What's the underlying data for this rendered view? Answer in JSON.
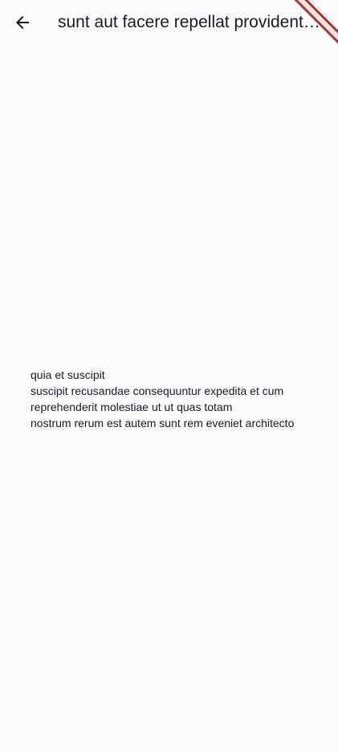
{
  "app_bar": {
    "back_icon": "arrow-back-icon",
    "title": "sunt aut facere repellat provident occaecati excepturi optio reprehenderit"
  },
  "post": {
    "body_lines": [
      "quia et suscipit",
      "suscipit recusandae consequuntur expedita et cum",
      "reprehenderit molestiae ut ut quas totam",
      "nostrum rerum est autem sunt rem eveniet architecto"
    ]
  },
  "colors": {
    "background": "#fcfbfe",
    "text": "#1c1b1f",
    "debug_banner": "#a43c3c"
  }
}
